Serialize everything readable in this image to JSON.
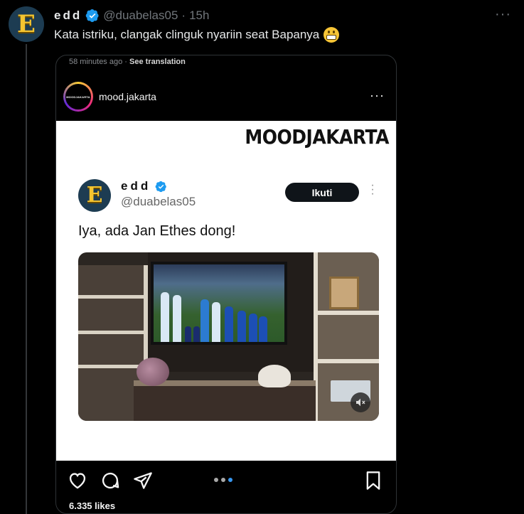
{
  "tweet": {
    "avatar_letter": "E",
    "display_name": "edd",
    "handle": "@duabelas05",
    "separator": "·",
    "time": "15h",
    "more_glyph": "···",
    "text": "Kata istriku, clangak clinguk nyariin seat Bapanya"
  },
  "media": {
    "meta_time": "58 minutes ago",
    "meta_separator": "·",
    "meta_link": "See translation",
    "ig_avatar_text": "MOODJAKARTA",
    "ig_username": "mood.jakarta",
    "ig_more": "···",
    "brand": "MOODJAKARTA",
    "inner_tweet": {
      "avatar_letter": "E",
      "display_name": "edd",
      "handle": "@duabelas05",
      "follow_label": "Ikuti",
      "text": "Iya, ada Jan Ethes dong!"
    },
    "likes": "6.335 likes",
    "carousel": {
      "count": 3,
      "active_index": 2
    }
  },
  "colors": {
    "background": "#000000",
    "text_primary": "#e7e9ea",
    "text_secondary": "#71767b",
    "verified": "#1d9bf0",
    "avatar_bg": "#1d3c52",
    "avatar_letter": "#f4c430",
    "carousel_active": "#3897f0"
  },
  "icons": [
    "verified-badge-icon",
    "grimace-emoji-icon",
    "more-icon",
    "heart-icon",
    "comment-icon",
    "share-icon",
    "bookmark-icon",
    "mute-icon"
  ]
}
